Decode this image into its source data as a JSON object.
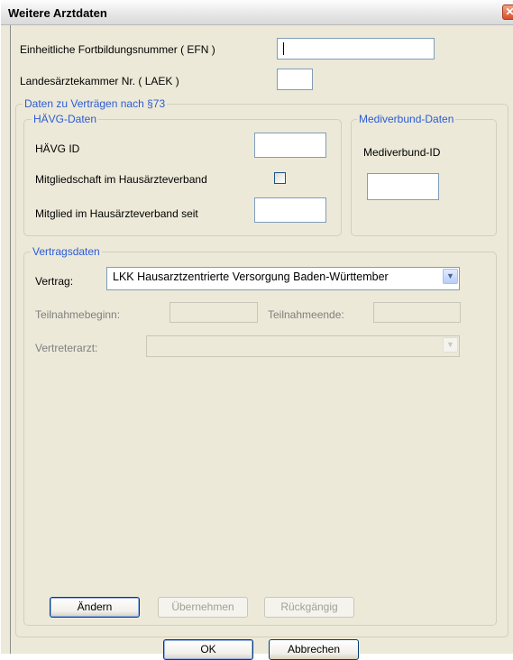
{
  "window": {
    "title": "Weitere Arztdaten",
    "close_symbol": "✕"
  },
  "fields": {
    "efn_label": "Einheitliche Fortbildungsnummer ( EFN )",
    "efn_value": "",
    "laek_label": "Landesärztekammer Nr. ( LAEK )",
    "laek_value": ""
  },
  "contracts_group": {
    "legend": "Daten zu Verträgen nach §73",
    "haevg": {
      "legend": "HÄVG-Daten",
      "id_label": "HÄVG ID",
      "id_value": "",
      "membership_label": "Mitgliedschaft im Hausärzteverband",
      "membership_checked": false,
      "member_since_label": "Mitglied im Hausärzteverband seit",
      "member_since_value": ""
    },
    "mediverbund": {
      "legend": "Mediverbund-Daten",
      "id_label": "Mediverbund-ID",
      "id_value": ""
    },
    "vertragsdaten": {
      "legend": "Vertragsdaten",
      "vertrag_label": "Vertrag:",
      "vertrag_value": "LKK Hausarztzentrierte Versorgung Baden-Württember",
      "start_label": "Teilnahmebeginn:",
      "end_label": "Teilnahmeende:",
      "vertreter_label": "Vertreterarzt:",
      "vertreter_value": ""
    },
    "buttons": {
      "change": "Ändern",
      "apply": "Übernehmen",
      "undo": "Rückgängig"
    }
  },
  "footer": {
    "ok": "OK",
    "cancel": "Abbrechen"
  },
  "icons": {
    "dropdown": "chevron-down-icon",
    "close": "close-icon"
  },
  "colors": {
    "accent_text": "#2b5bd6",
    "dialog_bg": "#ece9d8",
    "close_button": "#d8502b"
  }
}
